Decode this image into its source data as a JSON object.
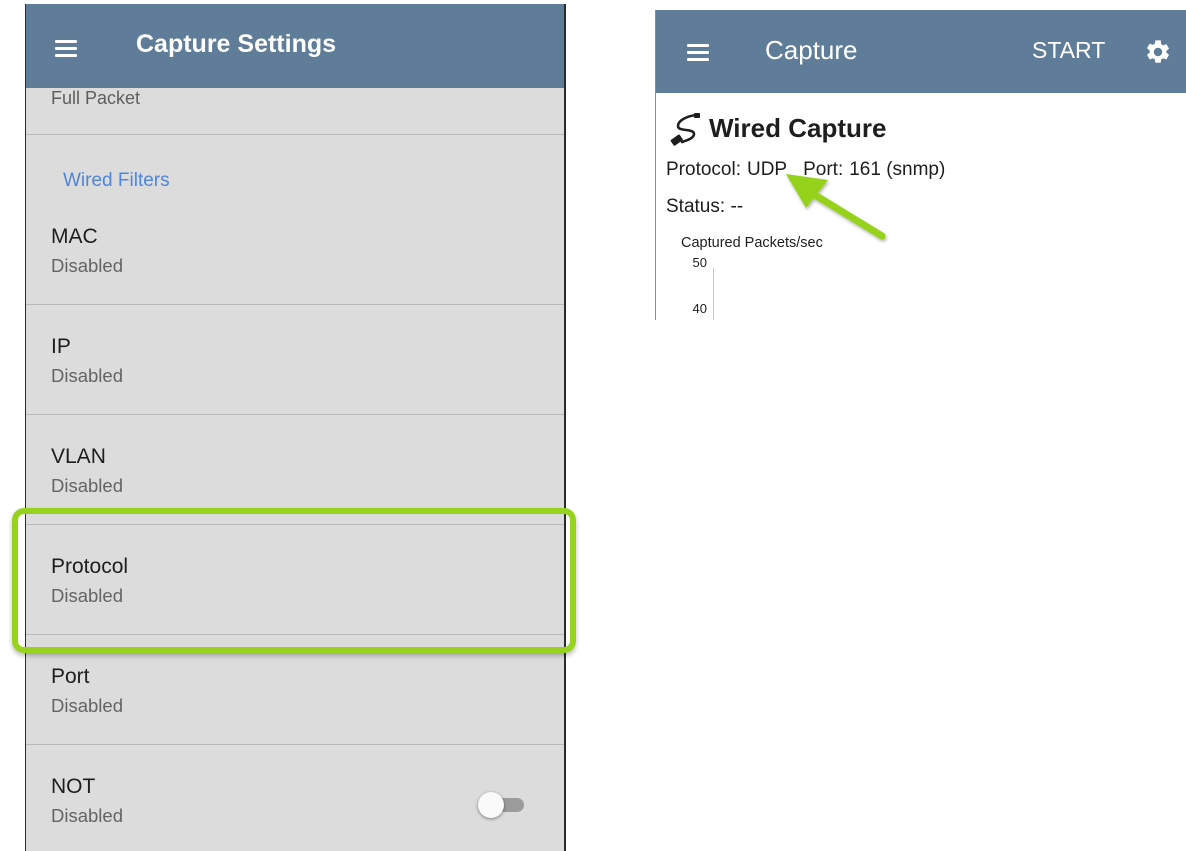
{
  "left_screen": {
    "title": "Capture Settings",
    "menu_icon": "hamburger-menu-icon",
    "partial_item": "Full Packet",
    "section_header": "Wired Filters",
    "items": [
      {
        "title": "MAC",
        "value": "Disabled"
      },
      {
        "title": "IP",
        "value": "Disabled"
      },
      {
        "title": "VLAN",
        "value": "Disabled"
      },
      {
        "title": "Protocol",
        "value": "Disabled"
      },
      {
        "title": "Port",
        "value": "Disabled"
      },
      {
        "title": "NOT",
        "value": "Disabled",
        "toggle": false
      }
    ],
    "highlight_color": "#96d21e"
  },
  "right_screen": {
    "title": "Capture",
    "menu_icon": "hamburger-menu-icon",
    "start_label": "START",
    "settings_icon": "gear-icon",
    "heading_icon": "ethernet-cable-icon",
    "heading": "Wired Capture",
    "protocol_label": "Protocol:",
    "protocol_value": "UDP",
    "port_label": "Port:",
    "port_value": "161 (snmp)",
    "status_label": "Status:",
    "status_value": "--",
    "chart_title": "Captured Packets/sec",
    "y_ticks": [
      "50",
      "40"
    ],
    "arrow_color": "#96d21e"
  },
  "colors": {
    "appbar": "#5f7c98",
    "section_header": "#4f86d9",
    "list_background": "#dcdcdc"
  }
}
